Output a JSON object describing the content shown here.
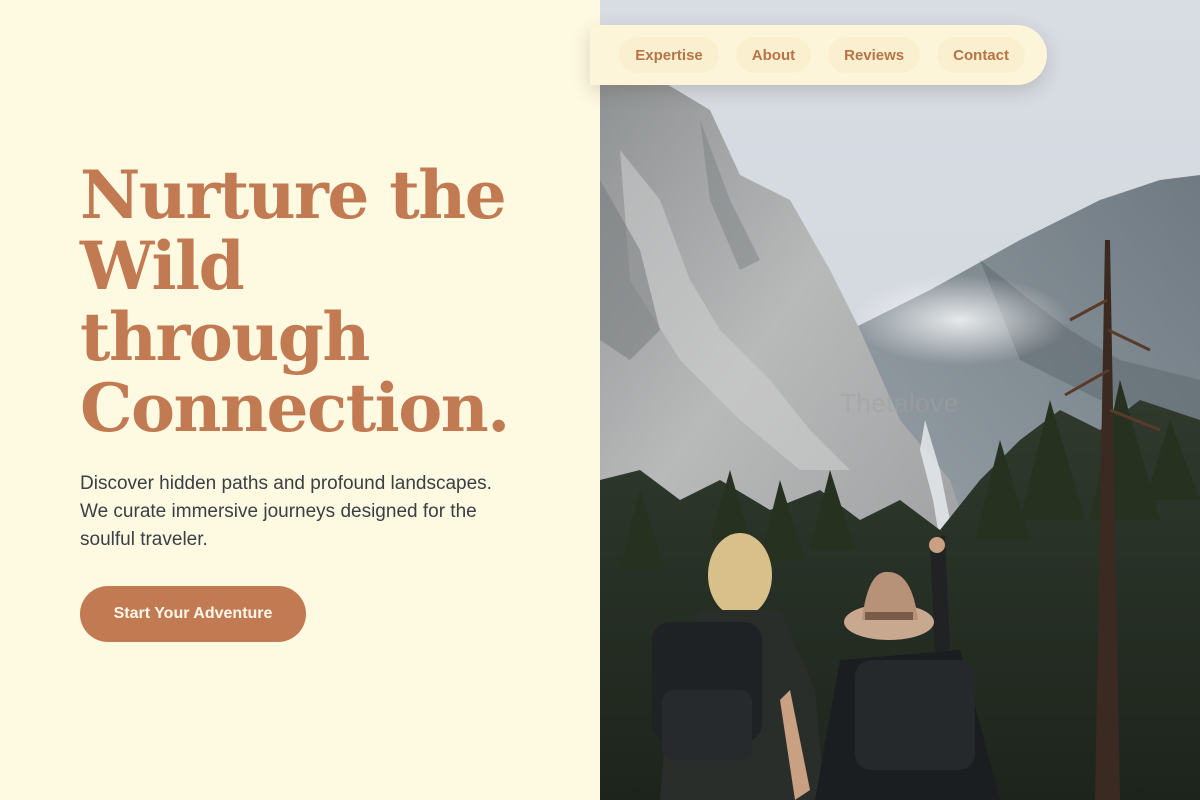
{
  "hero": {
    "title_lines": [
      "Nurture the",
      "Wild",
      "through",
      "Connection."
    ],
    "description": "Discover hidden paths and profound landscapes. We curate immersive journeys designed for the soulful traveler.",
    "cta_label": "Start Your Adventure"
  },
  "nav": {
    "links": [
      {
        "label": "Expertise"
      },
      {
        "label": "About"
      },
      {
        "label": "Reviews"
      },
      {
        "label": "Contact"
      }
    ]
  },
  "image": {
    "watermark": "Thetalove",
    "subject": "two hikers with backpacks overlooking a mountain valley"
  },
  "colors": {
    "background": "#fef9e1",
    "accent": "#c17a52",
    "text": "#3a3f46",
    "nav_background": "#fdf5d9"
  }
}
